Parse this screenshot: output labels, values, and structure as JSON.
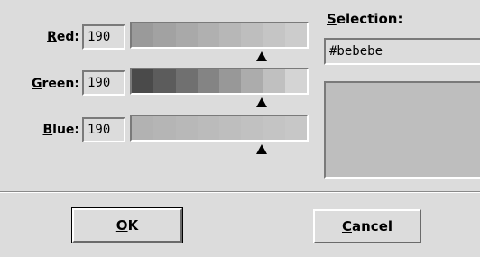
{
  "red": {
    "label_mnemonic": "R",
    "label_rest": "ed:",
    "value": "190",
    "scale": [
      "#9a9a9a",
      "#a2a2a2",
      "#a9a9a9",
      "#b0b0b0",
      "#b7b7b7",
      "#bebebe",
      "#c5c5c5",
      "#cccccc"
    ]
  },
  "green": {
    "label_mnemonic": "G",
    "label_rest": "reen:",
    "value": "190",
    "scale": [
      "#4a4a4a",
      "#5c5c5c",
      "#707070",
      "#848484",
      "#989898",
      "#acacac",
      "#c0c0c0",
      "#d4d4d4"
    ]
  },
  "blue": {
    "label_mnemonic": "B",
    "label_rest": "lue:",
    "value": "190",
    "scale": [
      "#b2b2b2",
      "#b5b5b5",
      "#b8b8b8",
      "#bbbbbb",
      "#bebebe",
      "#c1c1c1",
      "#c4c4c4",
      "#c7c7c7"
    ]
  },
  "selection": {
    "label_mnemonic": "S",
    "label_rest": "election:",
    "value": "#bebebe",
    "color": "#bebebe"
  },
  "buttons": {
    "ok": {
      "mnemonic": "O",
      "rest": "K"
    },
    "cancel": {
      "mnemonic": "C",
      "rest": "ancel"
    }
  }
}
